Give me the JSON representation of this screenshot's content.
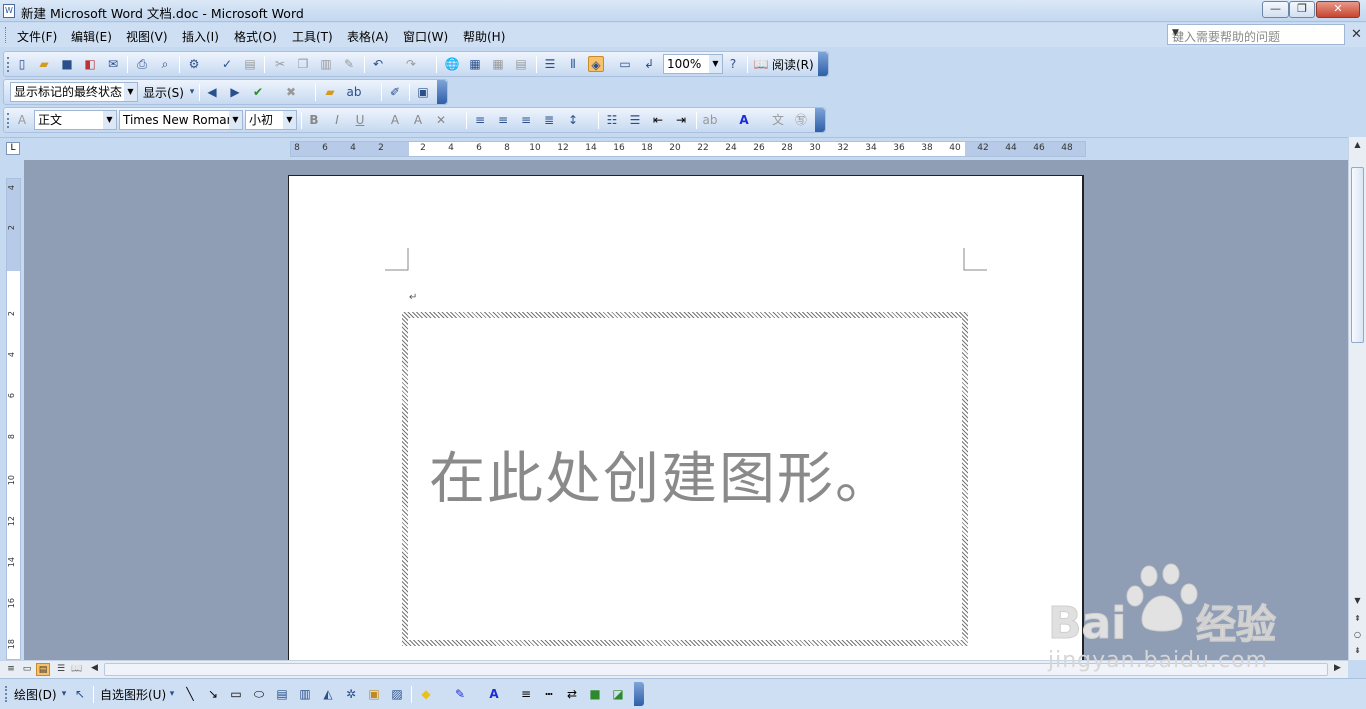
{
  "window": {
    "title": "新建 Microsoft Word 文档.doc - Microsoft Word",
    "minimize": "—",
    "restore": "❐",
    "close": "✕"
  },
  "menu": {
    "items": [
      "文件(F)",
      "编辑(E)",
      "视图(V)",
      "插入(I)",
      "格式(O)",
      "工具(T)",
      "表格(A)",
      "窗口(W)",
      "帮助(H)"
    ],
    "help_placeholder": "键入需要帮助的问题",
    "close_doc": "✕"
  },
  "standard_toolbar": {
    "zoom": "100%",
    "read_button": "阅读(R)"
  },
  "review_toolbar": {
    "display_mode": "显示标记的最终状态",
    "show_button": "显示(S)"
  },
  "format_toolbar": {
    "style": "正文",
    "font": "Times New Roman",
    "size": "小初"
  },
  "ruler": {
    "h_ticks": [
      "8",
      "6",
      "4",
      "2",
      "2",
      "4",
      "6",
      "8",
      "10",
      "12",
      "14",
      "16",
      "18",
      "20",
      "22",
      "24",
      "26",
      "28",
      "30",
      "32",
      "34",
      "36",
      "38",
      "40",
      "42",
      "44",
      "46",
      "48"
    ],
    "v_ticks": [
      "4",
      "2",
      "2",
      "4",
      "6",
      "8",
      "10",
      "12",
      "14",
      "16",
      "18"
    ]
  },
  "document": {
    "canvas_text": "在此处创建图形。"
  },
  "drawing_toolbar": {
    "draw_menu": "绘图(D)",
    "autoshapes_menu": "自选图形(U)"
  },
  "watermark": {
    "brand": "Bai du 经验",
    "url": "jingyan.baidu.com"
  },
  "colors": {
    "accent": "#c5d9f1",
    "toolbar_end": "#2f5fa8",
    "active": "#f8c26a"
  }
}
